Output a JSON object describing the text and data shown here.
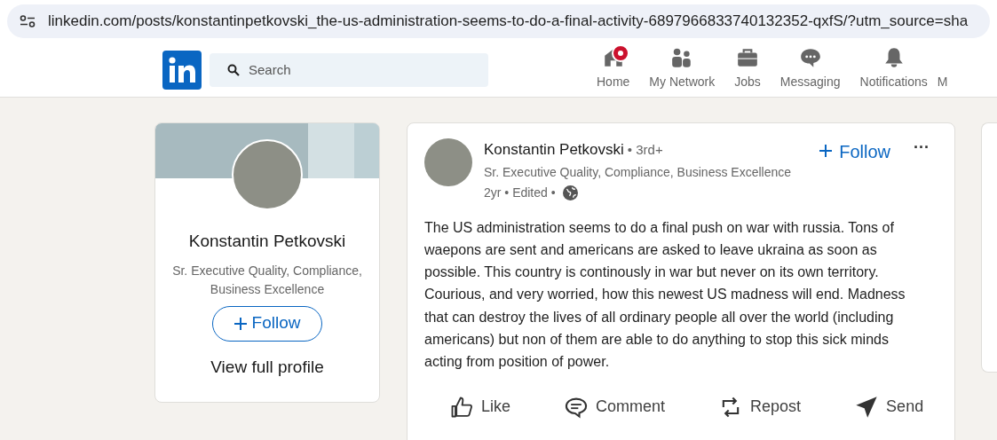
{
  "address_bar": {
    "url": "linkedin.com/posts/konstantinpetkovski_the-us-administration-seems-to-do-a-final-activity-6897966833740132352-qxfS/?utm_source=sha"
  },
  "nav": {
    "search": {
      "placeholder": "Search"
    },
    "items": [
      {
        "kind": "home",
        "label": "Home",
        "badge": true
      },
      {
        "kind": "network",
        "label": "My Network",
        "badge": false
      },
      {
        "kind": "jobs",
        "label": "Jobs",
        "badge": false
      },
      {
        "kind": "messaging",
        "label": "Messaging",
        "badge": false
      },
      {
        "kind": "notifications",
        "label": "Notifications",
        "badge": false
      },
      {
        "kind": "cut",
        "label": "M",
        "badge": false
      }
    ]
  },
  "profile_card": {
    "name": "Konstantin Petkovski",
    "headline": "Sr. Executive Quality, Compliance, Business Excellence",
    "follow": "Follow",
    "view_profile": "View full profile"
  },
  "post": {
    "author": "Konstantin Petkovski",
    "degree": "• 3rd+",
    "headline": "Sr. Executive Quality, Compliance, Business Excellence",
    "meta": "2yr • Edited •",
    "follow": "Follow",
    "more": "···",
    "body": "The US administration seems to do a final push on war with russia. Tons of waepons are sent and americans are asked to leave ukraina as soon as possible. This country is continously in war but never on its own territory. Courious, and very worried, how this newest US madness will end. Madness that can destroy the lives of all ordinary people all over the world (including americans) but non of them are able to do anything to stop this sick minds acting from position of power.",
    "actions": [
      {
        "kind": "like",
        "label": "Like"
      },
      {
        "kind": "comment",
        "label": "Comment"
      },
      {
        "kind": "repost",
        "label": "Repost"
      },
      {
        "kind": "send",
        "label": "Send"
      }
    ]
  }
}
